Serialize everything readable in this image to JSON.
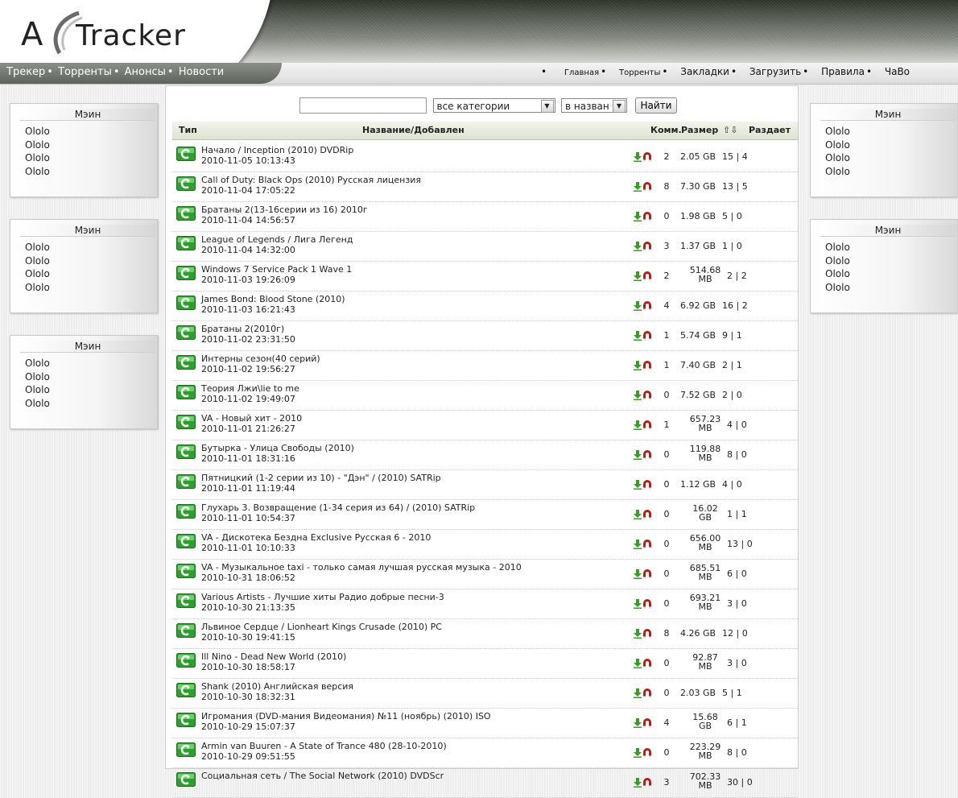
{
  "brand": {
    "logo_a": "A",
    "logo_rest": "Tracker"
  },
  "nav_left": [
    "Трекер",
    "Торренты",
    "Анонсы",
    "Новости"
  ],
  "nav_right": [
    "Главная",
    "Торренты",
    "Закладки",
    "Загрузить",
    "Правила",
    "ЧаВо"
  ],
  "left_boxes": [
    {
      "title": "Мэин",
      "items": [
        "Ololo",
        "Ololo",
        "Ololo",
        "Ololo"
      ]
    },
    {
      "title": "Мэин",
      "items": [
        "Ololo",
        "Ololo",
        "Ololo",
        "Ololo"
      ]
    },
    {
      "title": "Мэин",
      "items": [
        "Ololo",
        "Ololo",
        "Ololo",
        "Ololo"
      ]
    }
  ],
  "right_boxes": [
    {
      "title": "Мэин",
      "items": [
        "Ololo",
        "Ololo",
        "Ololo",
        "Ololo"
      ]
    },
    {
      "title": "Мэин",
      "items": [
        "Ololo",
        "Ololo",
        "Ololo",
        "Ololo"
      ]
    }
  ],
  "search": {
    "input_value": "",
    "category_selected": "все категории",
    "scope_selected": "в назван",
    "button_label": "Найти"
  },
  "table": {
    "headers": {
      "type": "Тип",
      "name": "Название/Добавлен",
      "comments": "Комм.",
      "size": "Размер",
      "seeds": "Раздает"
    },
    "rows": [
      {
        "title": "Начало / Inception (2010) DVDRip",
        "date": "2010-11-05 10:13:43",
        "comments": "2",
        "size": "2.05 GB",
        "peers": "15 | 4"
      },
      {
        "title": "Call of Duty: Black Ops (2010) Русская лицензия",
        "date": "2010-11-04 17:05:22",
        "comments": "8",
        "size": "7.30 GB",
        "peers": "13 | 5"
      },
      {
        "title": "Братаны 2(13-16серии из 16) 2010г",
        "date": "2010-11-04 14:56:57",
        "comments": "0",
        "size": "1.98 GB",
        "peers": "5 | 0"
      },
      {
        "title": "League of Legends / Лига Легенд",
        "date": "2010-11-04 14:32:00",
        "comments": "3",
        "size": "1.37 GB",
        "peers": "1 | 0"
      },
      {
        "title": "Windows 7 Service Pack 1 Wave 1",
        "date": "2010-11-03 19:26:09",
        "comments": "2",
        "size": "514.68 MB",
        "peers": "2 | 2"
      },
      {
        "title": "James Bond: Blood Stone (2010)",
        "date": "2010-11-03 16:21:43",
        "comments": "4",
        "size": "6.92 GB",
        "peers": "16 | 2"
      },
      {
        "title": "Братаны 2(2010г)",
        "date": "2010-11-02 23:31:50",
        "comments": "1",
        "size": "5.74 GB",
        "peers": "9 | 1"
      },
      {
        "title": "Интерны сезон(40 серий)",
        "date": "2010-11-02 19:56:27",
        "comments": "1",
        "size": "7.40 GB",
        "peers": "2 | 1"
      },
      {
        "title": "Теория Лжи\\lie to me",
        "date": "2010-11-02 19:49:07",
        "comments": "0",
        "size": "7.52 GB",
        "peers": "2 | 0"
      },
      {
        "title": "VA - Новый хит - 2010",
        "date": "2010-11-01 21:26:27",
        "comments": "1",
        "size": "657.23 MB",
        "peers": "4 | 0"
      },
      {
        "title": "Бутырка - Улица Свободы (2010)",
        "date": "2010-11-01 18:31:16",
        "comments": "0",
        "size": "119.88 MB",
        "peers": "8 | 0"
      },
      {
        "title": "Пятницкий (1-2 серии из 10) - \"Дэн\" / (2010) SATRip",
        "date": "2010-11-01 11:19:44",
        "comments": "0",
        "size": "1.12 GB",
        "peers": "4 | 0"
      },
      {
        "title": "Глухарь 3. Возвращение (1-34 серия из 64) / (2010) SATRip",
        "date": "2010-11-01 10:54:37",
        "comments": "0",
        "size": "16.02 GB",
        "peers": "1 | 1"
      },
      {
        "title": "VA - Дискотека Бездна Exclusive Русская 6 - 2010",
        "date": "2010-11-01 10:10:33",
        "comments": "0",
        "size": "656.00 MB",
        "peers": "13 | 0"
      },
      {
        "title": "VA - Музыкальное taxi - только самая лучшая русская музыка - 2010",
        "date": "2010-10-31 18:06:52",
        "comments": "0",
        "size": "685.51 MB",
        "peers": "6 | 0"
      },
      {
        "title": "Various Artists - Лучшие хиты Радио добрые песни-3",
        "date": "2010-10-30 21:13:35",
        "comments": "0",
        "size": "693.21 MB",
        "peers": "3 | 0"
      },
      {
        "title": "Львиное Сердце / Lionheart Kings Crusade (2010) PC",
        "date": "2010-10-30 19:41:15",
        "comments": "8",
        "size": "4.26 GB",
        "peers": "12 | 0"
      },
      {
        "title": "Ill Nino - Dead New World (2010)",
        "date": "2010-10-30 18:58:17",
        "comments": "0",
        "size": "92.87 MB",
        "peers": "3 | 0"
      },
      {
        "title": "Shank (2010) Английская версия",
        "date": "2010-10-30 18:32:31",
        "comments": "0",
        "size": "2.03 GB",
        "peers": "5 | 1"
      },
      {
        "title": "Игромания (DVD-мания Видеомания) №11 (ноябрь) (2010) ISO",
        "date": "2010-10-29 15:07:37",
        "comments": "4",
        "size": "15.68 GB",
        "peers": "6 | 1"
      },
      {
        "title": "Armin van Buuren - A State of Trance 480 (28-10-2010)",
        "date": "2010-10-29 09:51:55",
        "comments": "0",
        "size": "223.29 MB",
        "peers": "8 | 0"
      },
      {
        "title": "Социальная сеть / The Social Network (2010) DVDScr",
        "date": "",
        "comments": "3",
        "size": "702.33 MB",
        "peers": "30 | 0"
      }
    ]
  },
  "icons": {
    "type": "green-torrent-icon",
    "download": "download-arrow-icon",
    "magnet": "magnet-icon",
    "sort": "sort-arrows-icon"
  },
  "colors": {
    "type_icon": "#2e9e2e",
    "download_icon": "#3a9a2a",
    "magnet_icon": "#b0201a",
    "header_bg": "#9aa095"
  }
}
